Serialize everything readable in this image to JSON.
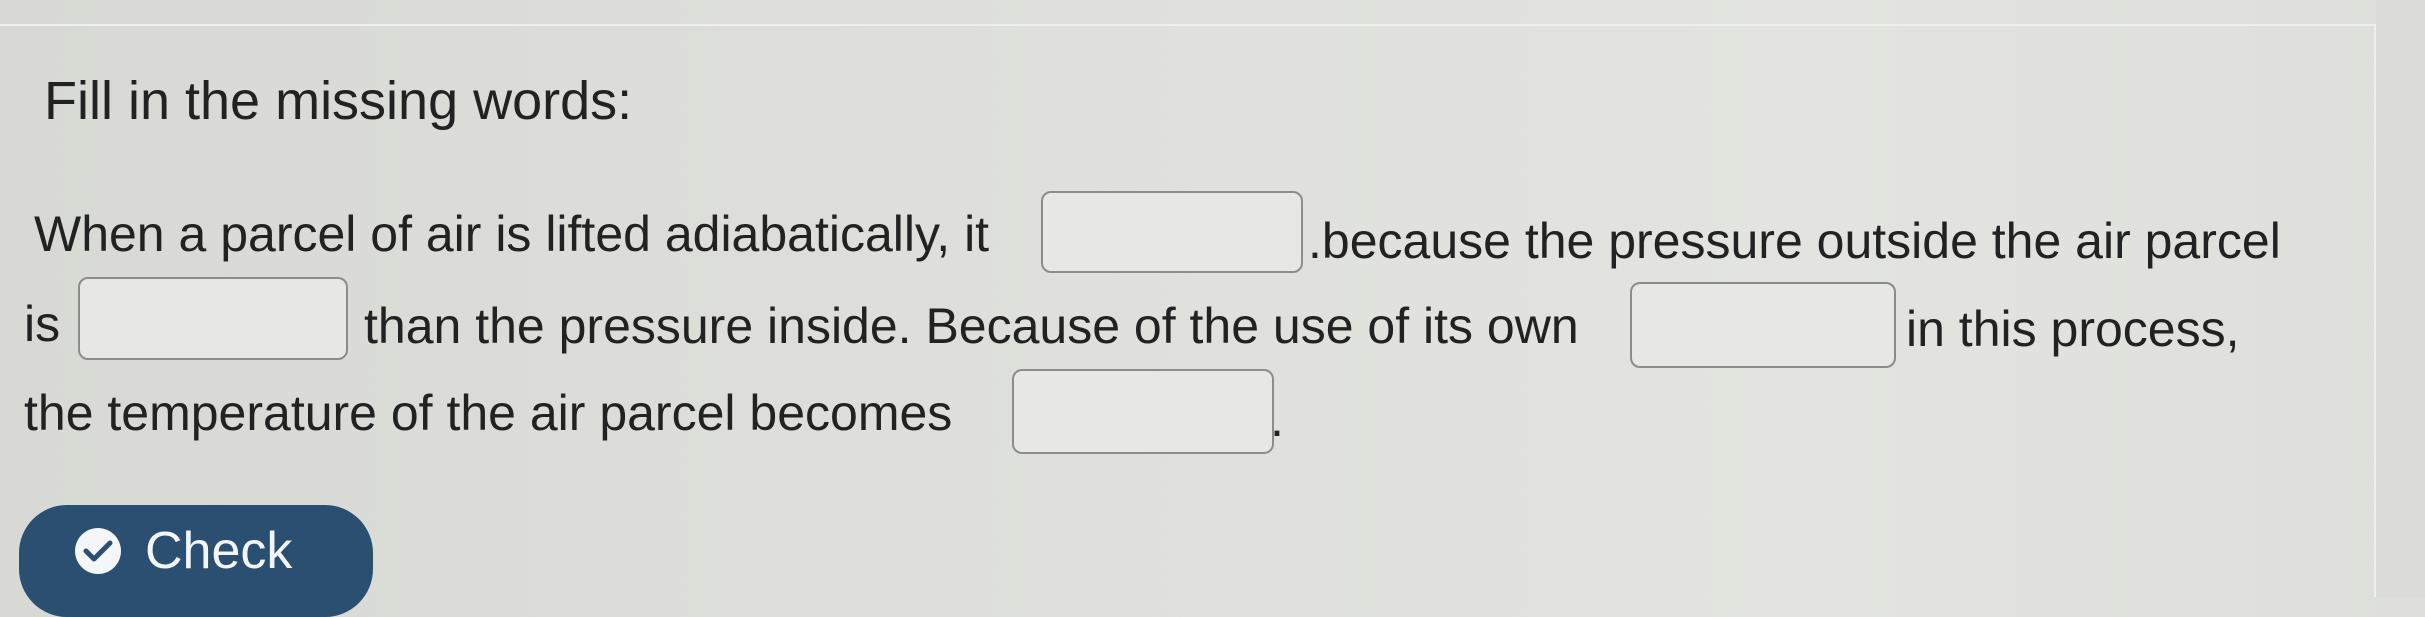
{
  "question": {
    "instruction": "Fill in the missing words:",
    "sentence": {
      "line1_before_blank1": "When a parcel of air is lifted adiabatically, it",
      "line1_after_blank1": ".because the pressure outside the air parcel",
      "line2_before_blank2": "is",
      "line2_after_blank2": "than the pressure inside. Because of the use of its own",
      "line2_after_blank3": "in this process,",
      "line3_before_blank4": "the temperature of the air parcel becomes",
      "line3_after_blank4": "."
    },
    "blanks": [
      {
        "value": ""
      },
      {
        "value": ""
      },
      {
        "value": ""
      },
      {
        "value": ""
      }
    ]
  },
  "actions": {
    "check_label": "Check",
    "check_icon": "check-circle-icon"
  },
  "colors": {
    "button_bg": "#2b4f70",
    "button_text": "#f3f6f9",
    "page_bg": "#dfe0db",
    "blank_border": "#8c8c88"
  }
}
